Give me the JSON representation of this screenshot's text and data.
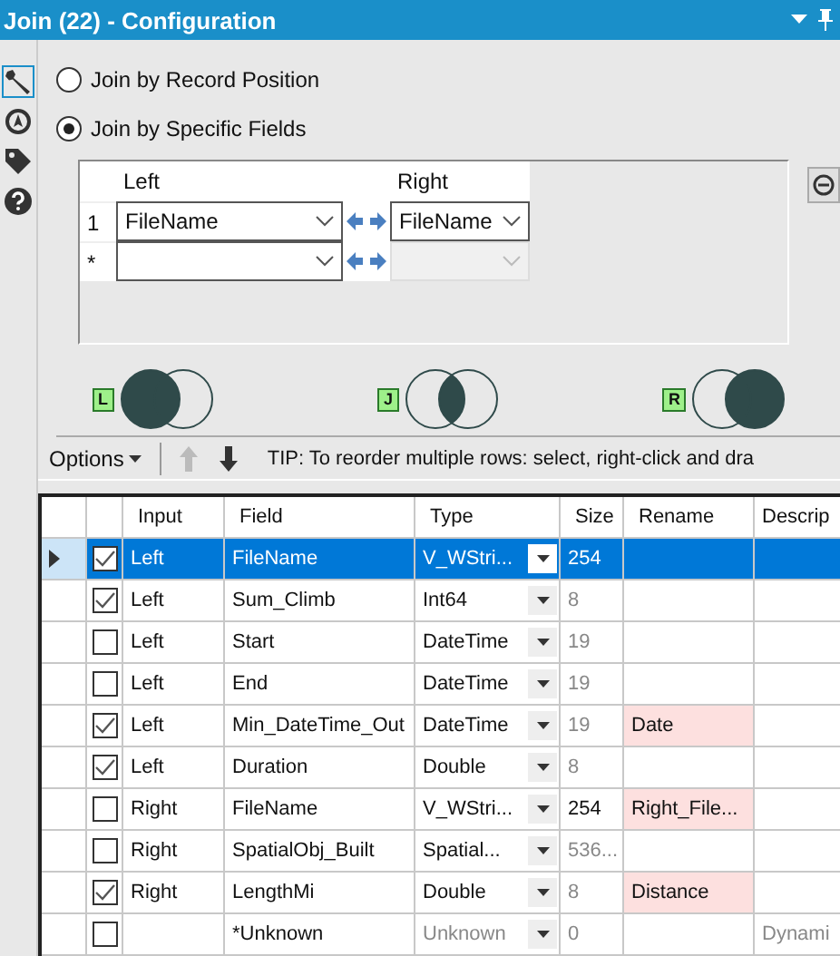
{
  "window": {
    "title": "Join (22) - Configuration"
  },
  "sidebar": {
    "items": [
      {
        "kind": "wrench",
        "selected": true
      },
      {
        "kind": "compass",
        "selected": false
      },
      {
        "kind": "tag",
        "selected": false
      },
      {
        "kind": "help",
        "selected": false
      }
    ]
  },
  "join_modes": [
    {
      "label": "Join by Record Position",
      "selected": false
    },
    {
      "label": "Join by Specific Fields",
      "selected": true
    }
  ],
  "join_fields": {
    "columns": [
      "Left",
      "Right"
    ],
    "rows": [
      {
        "index": "1",
        "left": "FileName",
        "right": "FileName",
        "right_disabled": false
      },
      {
        "index": "*",
        "right_disabled": true
      }
    ]
  },
  "outputs": [
    {
      "badge": "L",
      "kind": "left"
    },
    {
      "badge": "J",
      "kind": "join"
    },
    {
      "badge": "R",
      "kind": "right"
    }
  ],
  "toolbar": {
    "options": "Options",
    "move_buttons": [
      {
        "kind": "up",
        "disabled": true
      },
      {
        "kind": "down",
        "disabled": false
      }
    ],
    "tip": "TIP: To reorder multiple rows: select, right-click and dra"
  },
  "fields_table": {
    "columns": [
      "Input",
      "Field",
      "Type",
      "Size",
      "Rename",
      "Descrip"
    ],
    "rows": [
      {
        "selected": true,
        "checked": true,
        "input": "Left",
        "field": "FileName",
        "type": "V_WStri...",
        "type_disabled": false,
        "size": "254",
        "size_disabled": false
      },
      {
        "selected": false,
        "checked": true,
        "input": "Left",
        "field": "Sum_Climb",
        "type": "Int64",
        "type_disabled": false,
        "size": "8",
        "size_disabled": true
      },
      {
        "selected": false,
        "checked": false,
        "input": "Left",
        "field": "Start",
        "type": "DateTime",
        "type_disabled": false,
        "size": "19",
        "size_disabled": true
      },
      {
        "selected": false,
        "checked": false,
        "input": "Left",
        "field": "End",
        "type": "DateTime",
        "type_disabled": false,
        "size": "19",
        "size_disabled": true
      },
      {
        "selected": false,
        "checked": true,
        "input": "Left",
        "field": "Min_DateTime_Out",
        "type": "DateTime",
        "type_disabled": false,
        "size": "19",
        "size_disabled": true,
        "rename": "Date"
      },
      {
        "selected": false,
        "checked": true,
        "input": "Left",
        "field": "Duration",
        "type": "Double",
        "type_disabled": false,
        "size": "8",
        "size_disabled": true
      },
      {
        "selected": false,
        "checked": false,
        "input": "Right",
        "field": "FileName",
        "type": "V_WStri...",
        "type_disabled": false,
        "size": "254",
        "size_disabled": false,
        "rename": "Right_File..."
      },
      {
        "selected": false,
        "checked": false,
        "input": "Right",
        "field": "SpatialObj_Built",
        "type": "Spatial...",
        "type_disabled": false,
        "size": "536...",
        "size_disabled": true
      },
      {
        "selected": false,
        "checked": true,
        "input": "Right",
        "field": "LengthMi",
        "type": "Double",
        "type_disabled": false,
        "size": "8",
        "size_disabled": true,
        "rename": "Distance"
      },
      {
        "selected": false,
        "checked": false,
        "field": "*Unknown",
        "type": "Unknown",
        "type_disabled": true,
        "size": "0",
        "size_disabled": true,
        "description": "Dynami"
      }
    ]
  }
}
